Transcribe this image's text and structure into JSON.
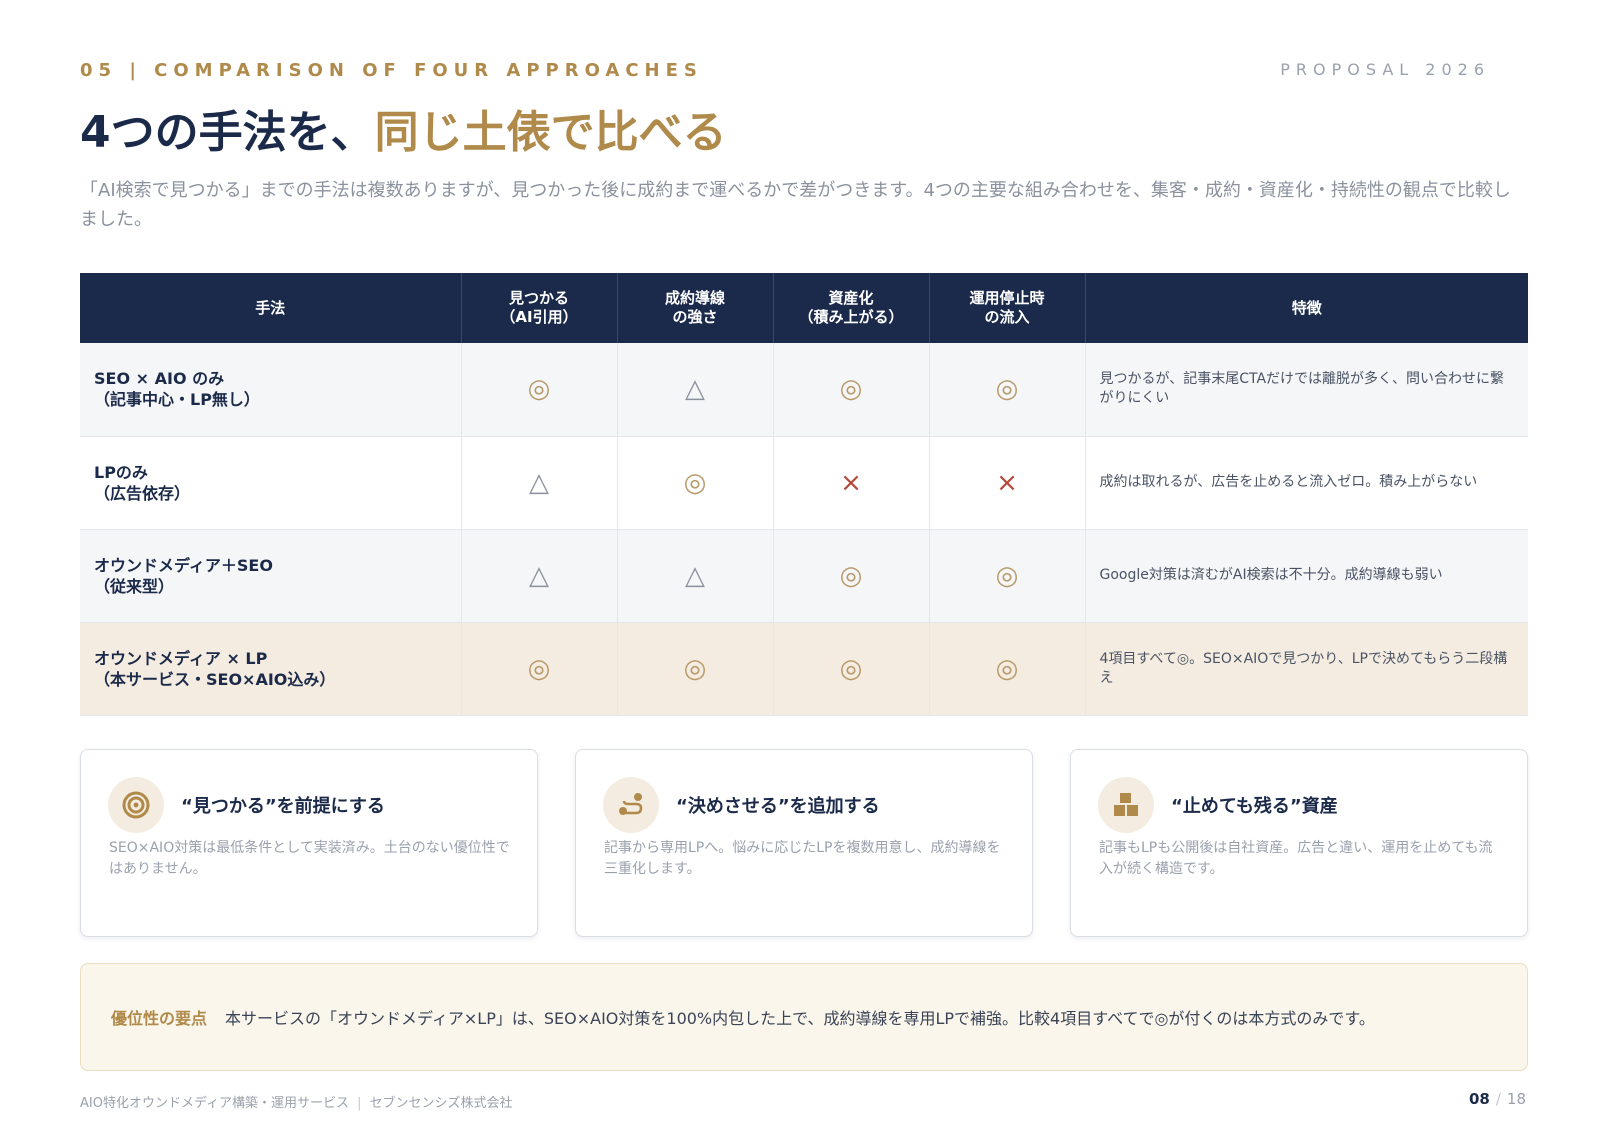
{
  "header": {
    "eyebrow": "05 | COMPARISON OF FOUR APPROACHES",
    "proposal": "PROPOSAL 2026",
    "title_main": "4つの手法を、",
    "title_accent": "同じ土俵で比べる",
    "lead": "「AI検索で見つかる」までの手法は複数ありますが、見つかった後に成約まで運べるかで差がつきます。4つの主要な組み合わせを、集客・成約・資産化・持続性の観点で比較しました。"
  },
  "table": {
    "headers": [
      {
        "line1": "手法",
        "line2": ""
      },
      {
        "line1": "見つかる",
        "line2": "（AI引用）"
      },
      {
        "line1": "成約導線",
        "line2": "の強さ"
      },
      {
        "line1": "資産化",
        "line2": "（積み上がる）"
      },
      {
        "line1": "運用停止時",
        "line2": "の流入"
      },
      {
        "line1": "特徴",
        "line2": ""
      }
    ],
    "rows": [
      {
        "method1": "SEO × AIO のみ",
        "method2": "（記事中心・LP無し）",
        "found": "◎",
        "conversion": "△",
        "asset": "◎",
        "after_stop": "◎",
        "feature": "見つかるが、記事末尾CTAだけでは離脱が多く、問い合わせに繋がりにくい"
      },
      {
        "method1": "LPのみ",
        "method2": "（広告依存）",
        "found": "△",
        "conversion": "◎",
        "asset": "×",
        "after_stop": "×",
        "feature": "成約は取れるが、広告を止めると流入ゼロ。積み上がらない"
      },
      {
        "method1": "オウンドメディア＋SEO",
        "method2": "（従来型）",
        "found": "△",
        "conversion": "△",
        "asset": "◎",
        "after_stop": "◎",
        "feature": "Google対策は済むがAI検索は不十分。成約導線も弱い"
      },
      {
        "method1": "オウンドメディア × LP",
        "method2": "（本サービス・SEO×AIO込み）",
        "found": "◎",
        "conversion": "◎",
        "asset": "◎",
        "after_stop": "◎",
        "feature": "4項目すべて◎。SEO×AIOで見つかり、LPで決めてもらう二段構え"
      }
    ]
  },
  "cards": [
    {
      "icon": "target-icon",
      "title": "“見つかる”を前提にする",
      "body": "SEO×AIO対策は最低条件として実装済み。土台のない優位性ではありません。"
    },
    {
      "icon": "route-icon",
      "title": "“決めさせる”を追加する",
      "body": "記事から専用LPへ。悩みに応じたLPを複数用意し、成約導線を三重化します。"
    },
    {
      "icon": "boxes-icon",
      "title": "“止めても残る”資産",
      "body": "記事もLPも公開後は自社資産。広告と違い、運用を止めても流入が続く構造です。"
    }
  ],
  "key_point": {
    "label": "優位性の要点",
    "text": "本サービスの「オウンドメディア×LP」は、SEO×AIO対策を100%内包した上で、成約導線を専用LPで補強。比較4項目すべてで◎が付くのは本方式のみです。"
  },
  "footer": {
    "service": "AIO特化オウンドメディア構築・運用サービス",
    "divider": "|",
    "company": "セブンセンシズ株式会社",
    "page_current": "08",
    "page_sep": "/",
    "page_total": "18"
  },
  "colors": {
    "navy": "#1b2a4b",
    "gold": "#b08a4a",
    "highlight_row": "#f4ece0",
    "bad_mark": "#b4473a"
  }
}
